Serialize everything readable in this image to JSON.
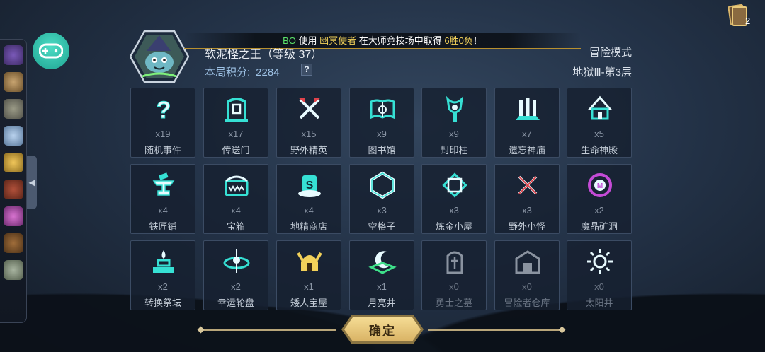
{
  "ticker": {
    "prefix": "BO",
    "t1": " 使用 ",
    "hero": "幽冥使者",
    "t2": " 在大师竞技场中取得 ",
    "result": "6胜0负",
    "t3": "！"
  },
  "boss": {
    "name": "软泥怪之王（等级 37）"
  },
  "score": {
    "label": "本局积分:",
    "value": "2284",
    "help": "?"
  },
  "mode": "冒险模式",
  "floor": "地狱Ⅲ-第3层",
  "inventory_count": "2",
  "confirm_label": "确定",
  "colors": {
    "accent": "#36e0d4",
    "gold": "#f2d15a",
    "ticker_green": "#5be36a"
  },
  "tiles": [
    {
      "label": "随机事件",
      "count": "x19",
      "icon": "question-icon"
    },
    {
      "label": "传送门",
      "count": "x17",
      "icon": "portal-icon"
    },
    {
      "label": "野外精英",
      "count": "x15",
      "icon": "crossed-axes-icon"
    },
    {
      "label": "图书馆",
      "count": "x9",
      "icon": "open-book-icon"
    },
    {
      "label": "封印柱",
      "count": "x9",
      "icon": "seal-pillar-icon"
    },
    {
      "label": "遗忘神庙",
      "count": "x7",
      "icon": "temple-icon"
    },
    {
      "label": "生命神殿",
      "count": "x5",
      "icon": "shrine-icon"
    },
    {
      "label": "铁匠铺",
      "count": "x4",
      "icon": "anvil-icon"
    },
    {
      "label": "宝箱",
      "count": "x4",
      "icon": "chest-icon"
    },
    {
      "label": "地精商店",
      "count": "x4",
      "icon": "shop-hat-icon"
    },
    {
      "label": "空格子",
      "count": "x3",
      "icon": "hexagon-icon"
    },
    {
      "label": "炼金小屋",
      "count": "x3",
      "icon": "alchemy-icon"
    },
    {
      "label": "野外小怪",
      "count": "x3",
      "icon": "crossed-swords-icon"
    },
    {
      "label": "魔晶矿洞",
      "count": "x2",
      "icon": "crystal-mine-icon"
    },
    {
      "label": "转换祭坛",
      "count": "x2",
      "icon": "altar-icon"
    },
    {
      "label": "幸运轮盘",
      "count": "x2",
      "icon": "wheel-icon"
    },
    {
      "label": "矮人宝屋",
      "count": "x1",
      "icon": "dwarf-helm-icon"
    },
    {
      "label": "月亮井",
      "count": "x1",
      "icon": "moon-well-icon"
    },
    {
      "label": "勇士之墓",
      "count": "x0",
      "icon": "tomb-icon"
    },
    {
      "label": "冒险者仓库",
      "count": "x0",
      "icon": "warehouse-icon"
    },
    {
      "label": "太阳井",
      "count": "x0",
      "icon": "sun-well-icon"
    }
  ],
  "side_items": [
    "pouch-icon",
    "scroll-icon",
    "totem-icon",
    "potion-icon",
    "key-icon",
    "meat-icon",
    "purple-orb-icon",
    "spellbook-icon",
    "tablet-icon"
  ]
}
